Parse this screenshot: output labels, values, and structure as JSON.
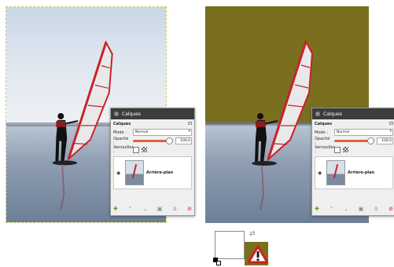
{
  "dock": {
    "title": "Calques",
    "section": "Calques",
    "mode_label": "Mode :",
    "mode_value": "Normal",
    "opacity_label": "Opacité :",
    "opacity_value": "100,0",
    "lock_label": "Verrouiller :",
    "layer_name": "Arrière-plan"
  },
  "colors": {
    "sky": "#dfe6ef",
    "olive": "#7a6f1f",
    "sail_red": "#c8222a",
    "delete_red": "#dd1111",
    "warning_red": "#d11f1f"
  },
  "icons": [
    "eye-icon",
    "new-layer-icon",
    "raise-layer-icon",
    "lower-layer-icon",
    "duplicate-layer-icon",
    "anchor-layer-icon",
    "delete-layer-icon",
    "swap-colors-icon",
    "warning-icon"
  ]
}
